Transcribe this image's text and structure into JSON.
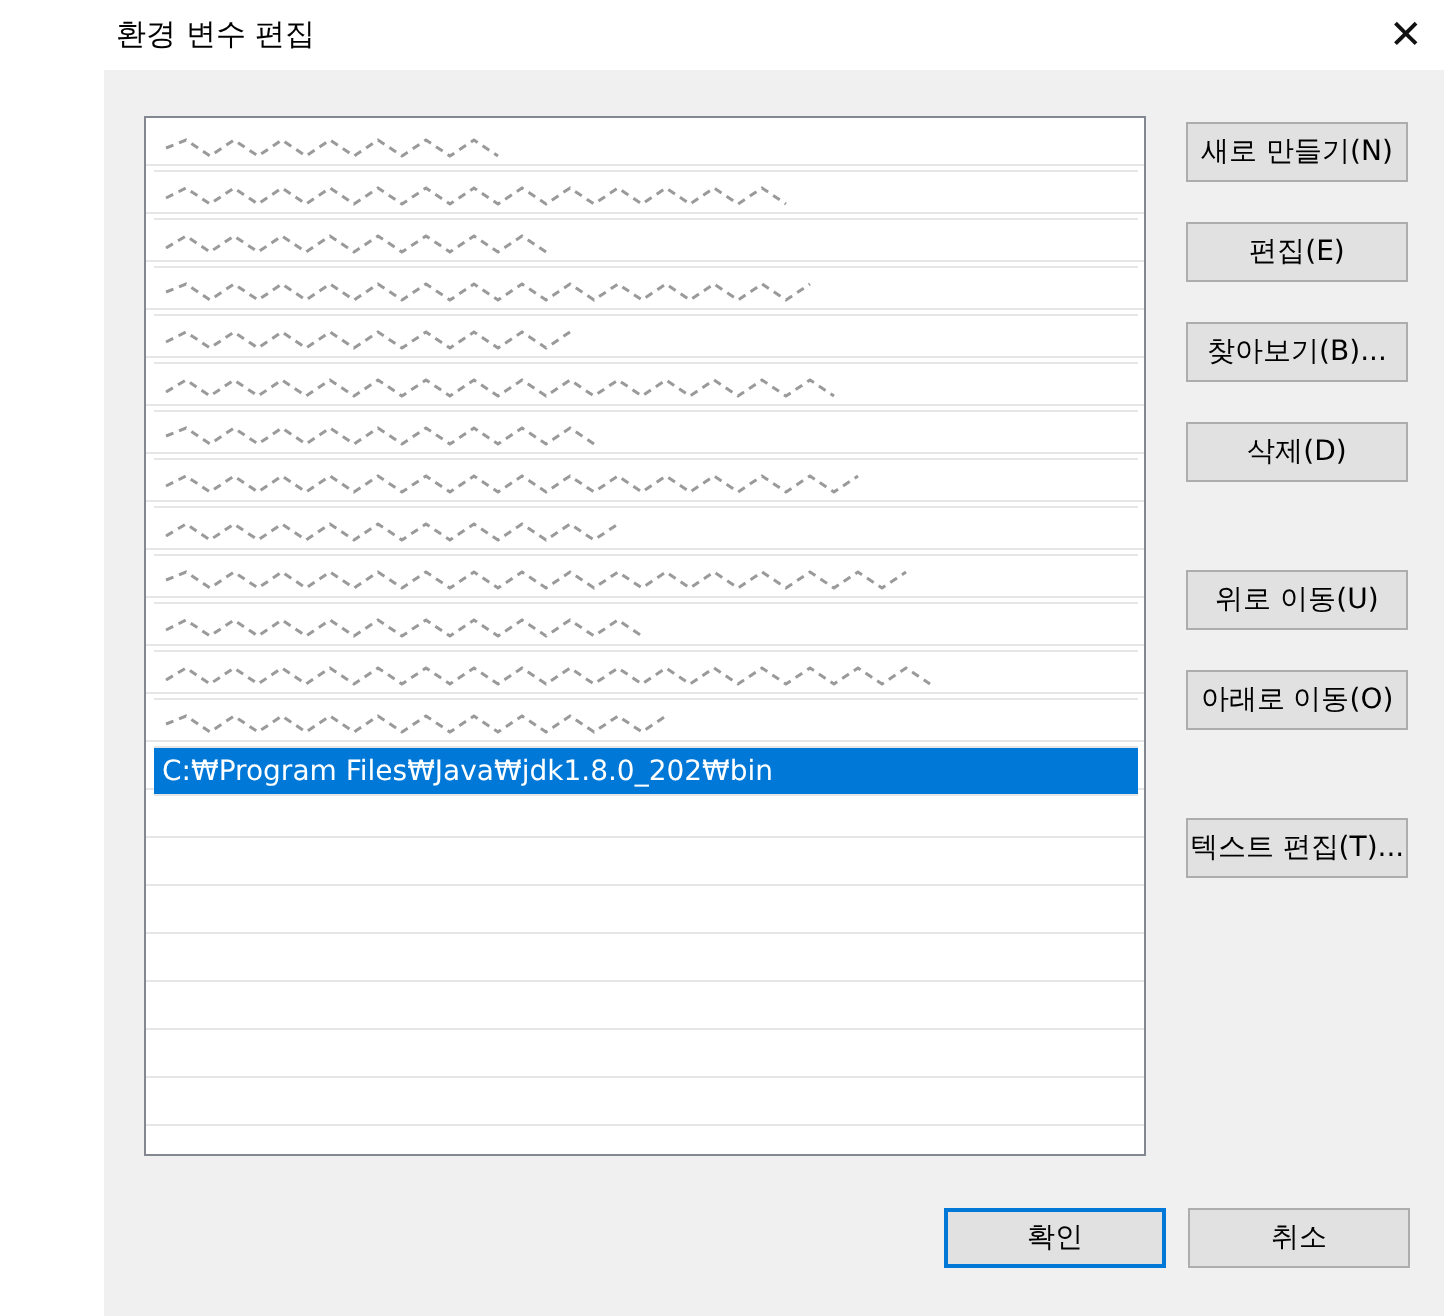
{
  "window": {
    "title": "환경 변수 편집",
    "close": "✕"
  },
  "paths": [
    {
      "redacted": true,
      "selected": false
    },
    {
      "redacted": true,
      "selected": false
    },
    {
      "redacted": true,
      "selected": false
    },
    {
      "redacted": true,
      "selected": false
    },
    {
      "redacted": true,
      "selected": false
    },
    {
      "redacted": true,
      "selected": false
    },
    {
      "redacted": true,
      "selected": false
    },
    {
      "redacted": true,
      "selected": false
    },
    {
      "redacted": true,
      "selected": false
    },
    {
      "redacted": true,
      "selected": false
    },
    {
      "redacted": true,
      "selected": false
    },
    {
      "redacted": true,
      "selected": false
    },
    {
      "redacted": true,
      "selected": false
    },
    {
      "redacted": false,
      "text": "C:₩Program Files₩Java₩jdk1.8.0_202₩bin",
      "selected": true
    }
  ],
  "button_groups": [
    [
      "새로 만들기(N)",
      "편집(E)",
      "찾아보기(B)...",
      "삭제(D)"
    ],
    [
      "위로 이동(U)",
      "아래로 이동(O)"
    ],
    [
      "텍스트 편집(T)..."
    ]
  ],
  "footer": [
    {
      "label": "확인",
      "default": true
    },
    {
      "label": "취소",
      "default": false
    }
  ]
}
